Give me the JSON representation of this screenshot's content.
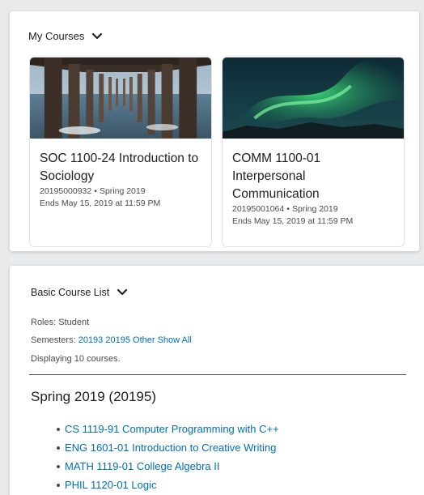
{
  "my_courses": {
    "title": "My Courses",
    "cards": [
      {
        "title": "SOC 1100-24 Introduction to Sociology",
        "code": "20195000932",
        "semester": "Spring 2019",
        "end": "Ends May 15, 2019 at 11:59 PM",
        "image": "pier-photo"
      },
      {
        "title": "COMM 1100-01 Interpersonal Communication",
        "code": "20195001064",
        "semester": "Spring 2019",
        "end": "Ends May 15, 2019 at 11:59 PM",
        "image": "aurora-photo"
      }
    ]
  },
  "basic_course_list": {
    "title": "Basic Course List",
    "roles_label": "Roles:",
    "roles_value": "Student",
    "semesters_label": "Semesters:",
    "semester_links": [
      "20193",
      "20195",
      "Other",
      "Show All"
    ],
    "displaying": "Displaying 10 courses.",
    "section_title": "Spring 2019 (20195)",
    "courses": [
      "CS 1119-91 Computer Programming with C++",
      "ENG 1601-01 Introduction to Creative Writing",
      "MATH 1119-01 College Algebra II",
      "PHIL 1120-01 Logic"
    ]
  },
  "colors": {
    "link": "#006fbf",
    "text": "#494c4e",
    "heading": "#202122"
  },
  "separator_dot": "•"
}
